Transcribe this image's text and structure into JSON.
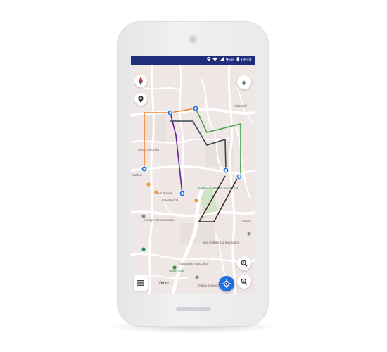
{
  "status_bar": {
    "battery": "95%",
    "time": "06:01",
    "signal": "signal-icon",
    "wifi": "wifi-icon",
    "location": "location-status-icon"
  },
  "map": {
    "compass": "N",
    "zoom_in": "+",
    "scale": "100 m",
    "place_labels": [
      "Church of Christ",
      "Team Sonias",
      "Bread World",
      "EMS Co-operative Society Ltd",
      "Kondiya Shivam Sadan",
      "Idea Cellular Ltd Mindspace",
      "Kakkanadu Post Office",
      "Onam Park",
      "Digital Service Center",
      "Kalluvazhi",
      "Emkay",
      "Kakkan"
    ],
    "routes": [
      {
        "name": "orange",
        "color": "#f5821f"
      },
      {
        "name": "purple",
        "color": "#6a1b9a"
      },
      {
        "name": "dark",
        "color": "#37474f"
      },
      {
        "name": "green",
        "color": "#43a047"
      },
      {
        "name": "brown",
        "color": "#3e2723"
      }
    ]
  },
  "colors": {
    "status_bar": "#1f2d7a",
    "accent": "#1e6fe0",
    "map_bg": "#eee7e5"
  }
}
